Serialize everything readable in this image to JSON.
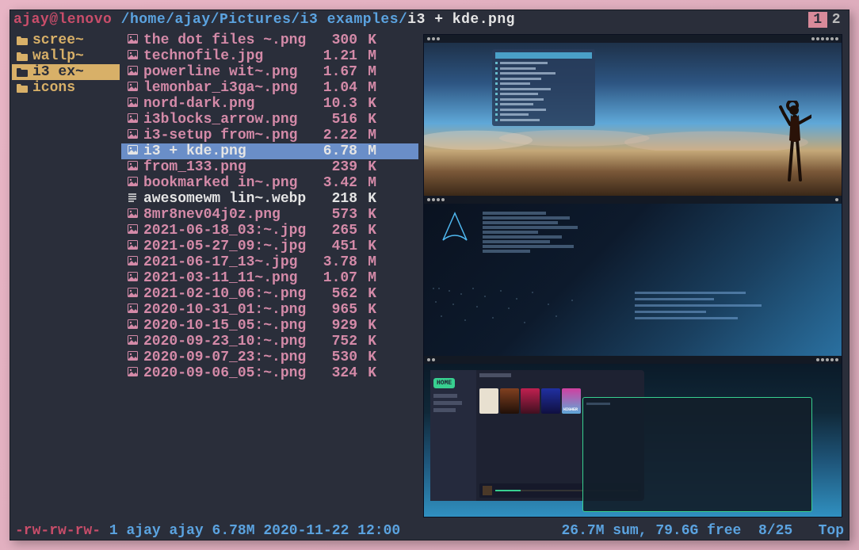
{
  "header": {
    "userhost": "ajay@lenovo",
    "path_prefix": "/home/ajay/Pictures/i3 examples/",
    "path_file": "i3 + kde.png"
  },
  "tabs": [
    {
      "label": "1",
      "active": true
    },
    {
      "label": "2",
      "active": false
    }
  ],
  "dirs": [
    {
      "name": "scree~",
      "selected": false
    },
    {
      "name": "wallp~",
      "selected": false
    },
    {
      "name": "i3 ex~",
      "selected": true
    },
    {
      "name": "icons",
      "selected": false
    }
  ],
  "files": [
    {
      "icon": "img",
      "name": "the dot files ~.png",
      "size": "300",
      "unit": "K",
      "selected": false,
      "white": false
    },
    {
      "icon": "img",
      "name": "technofile.jpg",
      "size": "1.21",
      "unit": "M",
      "selected": false,
      "white": false
    },
    {
      "icon": "img",
      "name": "powerline wit~.png",
      "size": "1.67",
      "unit": "M",
      "selected": false,
      "white": false
    },
    {
      "icon": "img",
      "name": "lemonbar_i3ga~.png",
      "size": "1.04",
      "unit": "M",
      "selected": false,
      "white": false
    },
    {
      "icon": "img",
      "name": "nord-dark.png",
      "size": "10.3",
      "unit": "K",
      "selected": false,
      "white": false
    },
    {
      "icon": "img",
      "name": "i3blocks_arrow.png",
      "size": "516",
      "unit": "K",
      "selected": false,
      "white": false
    },
    {
      "icon": "img",
      "name": "i3-setup from~.png",
      "size": "2.22",
      "unit": "M",
      "selected": false,
      "white": false
    },
    {
      "icon": "img",
      "name": "i3 + kde.png",
      "size": "6.78",
      "unit": "M",
      "selected": true,
      "white": false
    },
    {
      "icon": "img",
      "name": "from_133.png",
      "size": "239",
      "unit": "K",
      "selected": false,
      "white": false
    },
    {
      "icon": "img",
      "name": "bookmarked in~.png",
      "size": "3.42",
      "unit": "M",
      "selected": false,
      "white": false
    },
    {
      "icon": "txt",
      "name": "awesomewm lin~.webp",
      "size": "218",
      "unit": "K",
      "selected": false,
      "white": true
    },
    {
      "icon": "img",
      "name": "8mr8nev04j0z.png",
      "size": "573",
      "unit": "K",
      "selected": false,
      "white": false
    },
    {
      "icon": "img",
      "name": "2021-06-18_03:~.jpg",
      "size": "265",
      "unit": "K",
      "selected": false,
      "white": false
    },
    {
      "icon": "img",
      "name": "2021-05-27_09:~.jpg",
      "size": "451",
      "unit": "K",
      "selected": false,
      "white": false
    },
    {
      "icon": "img",
      "name": "2021-06-17_13~.jpg",
      "size": "3.78",
      "unit": "M",
      "selected": false,
      "white": false
    },
    {
      "icon": "img",
      "name": "2021-03-11_11~.png",
      "size": "1.07",
      "unit": "M",
      "selected": false,
      "white": false
    },
    {
      "icon": "img",
      "name": "2021-02-10_06:~.png",
      "size": "562",
      "unit": "K",
      "selected": false,
      "white": false
    },
    {
      "icon": "img",
      "name": "2020-10-31_01:~.png",
      "size": "965",
      "unit": "K",
      "selected": false,
      "white": false
    },
    {
      "icon": "img",
      "name": "2020-10-15_05:~.png",
      "size": "929",
      "unit": "K",
      "selected": false,
      "white": false
    },
    {
      "icon": "img",
      "name": "2020-09-23_10:~.png",
      "size": "752",
      "unit": "K",
      "selected": false,
      "white": false
    },
    {
      "icon": "img",
      "name": "2020-09-07_23:~.png",
      "size": "530",
      "unit": "K",
      "selected": false,
      "white": false
    },
    {
      "icon": "img",
      "name": "2020-09-06_05:~.png",
      "size": "324",
      "unit": "K",
      "selected": false,
      "white": false
    }
  ],
  "status": {
    "perm": "-rw-rw-rw-",
    "links": "1",
    "owner": "ajay",
    "group": "ajay",
    "size": "6.78M",
    "date": "2020-11-22",
    "time": "12:00",
    "sum": "26.7M sum,",
    "free": "79.6G free",
    "pos": "8/25",
    "scroll": "Top"
  },
  "preview": {
    "home_label": "HOME"
  }
}
